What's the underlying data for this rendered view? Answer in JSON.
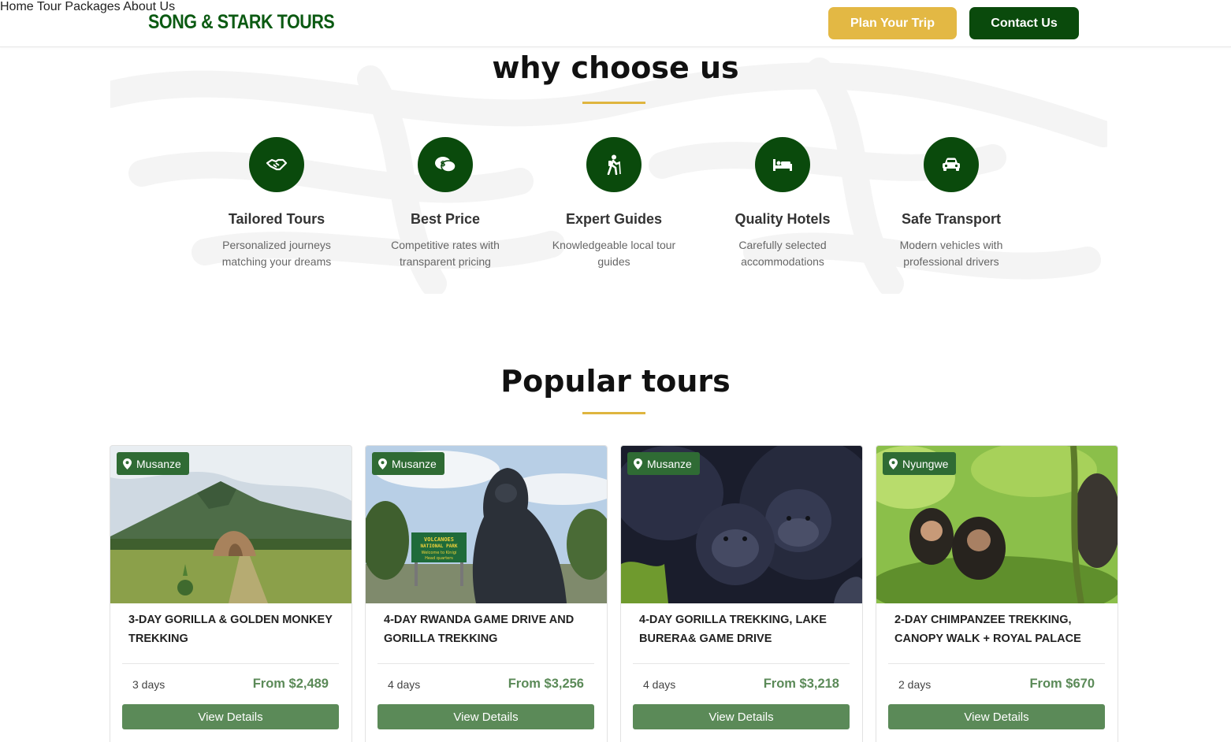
{
  "header": {
    "logo": "SONG & STARK TOURS",
    "nav": [
      "Home",
      "Tour Packages",
      "About Us"
    ],
    "plan_button": "Plan Your Trip",
    "contact_button": "Contact Us"
  },
  "why": {
    "title": "why choose us",
    "features": [
      {
        "title": "Tailored Tours",
        "text": "Personalized journeys matching your dreams",
        "icon": "handshake-icon"
      },
      {
        "title": "Best Price",
        "text": "Competitive rates with transparent pricing",
        "icon": "price-chat-icon"
      },
      {
        "title": "Expert Guides",
        "text": "Knowledgeable local tour guides",
        "icon": "hiking-icon"
      },
      {
        "title": "Quality Hotels",
        "text": "Carefully selected accommodations",
        "icon": "bed-icon"
      },
      {
        "title": "Safe Transport",
        "text": "Modern vehicles with professional drivers",
        "icon": "car-icon"
      }
    ]
  },
  "popular": {
    "title": "Popular tours",
    "tours": [
      {
        "location": "Musanze",
        "title": "3-Day Gorilla & Golden Monkey Trekking",
        "days": "3 days",
        "price": "From $2,489",
        "button": "View Details"
      },
      {
        "location": "Musanze",
        "title": "4-Day Rwanda Game Drive and Gorilla Trekking",
        "days": "4 days",
        "price": "From $3,256",
        "button": "View Details"
      },
      {
        "location": "Musanze",
        "title": "4-Day Gorilla Trekking, Lake Burera& Game Drive",
        "days": "4 days",
        "price": "From $3,218",
        "button": "View Details"
      },
      {
        "location": "Nyungwe",
        "title": "2-Day Chimpanzee Trekking, Canopy Walk + Royal Palace",
        "days": "2 days",
        "price": "From $670",
        "button": "View Details"
      }
    ],
    "sign_text": [
      "VOLCANOES",
      "NATIONAL PARK",
      "Welcome to Kinigi",
      "Head quarters"
    ]
  },
  "colors": {
    "brand_green": "#0a4a0c",
    "accent_gold": "#e3b844",
    "card_green": "#5b8a58"
  }
}
